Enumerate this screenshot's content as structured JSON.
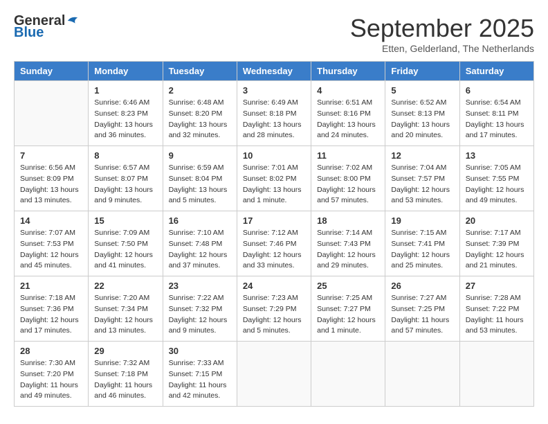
{
  "logo": {
    "general": "General",
    "blue": "Blue"
  },
  "header": {
    "month": "September 2025",
    "location": "Etten, Gelderland, The Netherlands"
  },
  "weekdays": [
    "Sunday",
    "Monday",
    "Tuesday",
    "Wednesday",
    "Thursday",
    "Friday",
    "Saturday"
  ],
  "weeks": [
    [
      {
        "day": "",
        "sunrise": "",
        "sunset": "",
        "daylight": ""
      },
      {
        "day": "1",
        "sunrise": "Sunrise: 6:46 AM",
        "sunset": "Sunset: 8:23 PM",
        "daylight": "Daylight: 13 hours and 36 minutes."
      },
      {
        "day": "2",
        "sunrise": "Sunrise: 6:48 AM",
        "sunset": "Sunset: 8:20 PM",
        "daylight": "Daylight: 13 hours and 32 minutes."
      },
      {
        "day": "3",
        "sunrise": "Sunrise: 6:49 AM",
        "sunset": "Sunset: 8:18 PM",
        "daylight": "Daylight: 13 hours and 28 minutes."
      },
      {
        "day": "4",
        "sunrise": "Sunrise: 6:51 AM",
        "sunset": "Sunset: 8:16 PM",
        "daylight": "Daylight: 13 hours and 24 minutes."
      },
      {
        "day": "5",
        "sunrise": "Sunrise: 6:52 AM",
        "sunset": "Sunset: 8:13 PM",
        "daylight": "Daylight: 13 hours and 20 minutes."
      },
      {
        "day": "6",
        "sunrise": "Sunrise: 6:54 AM",
        "sunset": "Sunset: 8:11 PM",
        "daylight": "Daylight: 13 hours and 17 minutes."
      }
    ],
    [
      {
        "day": "7",
        "sunrise": "Sunrise: 6:56 AM",
        "sunset": "Sunset: 8:09 PM",
        "daylight": "Daylight: 13 hours and 13 minutes."
      },
      {
        "day": "8",
        "sunrise": "Sunrise: 6:57 AM",
        "sunset": "Sunset: 8:07 PM",
        "daylight": "Daylight: 13 hours and 9 minutes."
      },
      {
        "day": "9",
        "sunrise": "Sunrise: 6:59 AM",
        "sunset": "Sunset: 8:04 PM",
        "daylight": "Daylight: 13 hours and 5 minutes."
      },
      {
        "day": "10",
        "sunrise": "Sunrise: 7:01 AM",
        "sunset": "Sunset: 8:02 PM",
        "daylight": "Daylight: 13 hours and 1 minute."
      },
      {
        "day": "11",
        "sunrise": "Sunrise: 7:02 AM",
        "sunset": "Sunset: 8:00 PM",
        "daylight": "Daylight: 12 hours and 57 minutes."
      },
      {
        "day": "12",
        "sunrise": "Sunrise: 7:04 AM",
        "sunset": "Sunset: 7:57 PM",
        "daylight": "Daylight: 12 hours and 53 minutes."
      },
      {
        "day": "13",
        "sunrise": "Sunrise: 7:05 AM",
        "sunset": "Sunset: 7:55 PM",
        "daylight": "Daylight: 12 hours and 49 minutes."
      }
    ],
    [
      {
        "day": "14",
        "sunrise": "Sunrise: 7:07 AM",
        "sunset": "Sunset: 7:53 PM",
        "daylight": "Daylight: 12 hours and 45 minutes."
      },
      {
        "day": "15",
        "sunrise": "Sunrise: 7:09 AM",
        "sunset": "Sunset: 7:50 PM",
        "daylight": "Daylight: 12 hours and 41 minutes."
      },
      {
        "day": "16",
        "sunrise": "Sunrise: 7:10 AM",
        "sunset": "Sunset: 7:48 PM",
        "daylight": "Daylight: 12 hours and 37 minutes."
      },
      {
        "day": "17",
        "sunrise": "Sunrise: 7:12 AM",
        "sunset": "Sunset: 7:46 PM",
        "daylight": "Daylight: 12 hours and 33 minutes."
      },
      {
        "day": "18",
        "sunrise": "Sunrise: 7:14 AM",
        "sunset": "Sunset: 7:43 PM",
        "daylight": "Daylight: 12 hours and 29 minutes."
      },
      {
        "day": "19",
        "sunrise": "Sunrise: 7:15 AM",
        "sunset": "Sunset: 7:41 PM",
        "daylight": "Daylight: 12 hours and 25 minutes."
      },
      {
        "day": "20",
        "sunrise": "Sunrise: 7:17 AM",
        "sunset": "Sunset: 7:39 PM",
        "daylight": "Daylight: 12 hours and 21 minutes."
      }
    ],
    [
      {
        "day": "21",
        "sunrise": "Sunrise: 7:18 AM",
        "sunset": "Sunset: 7:36 PM",
        "daylight": "Daylight: 12 hours and 17 minutes."
      },
      {
        "day": "22",
        "sunrise": "Sunrise: 7:20 AM",
        "sunset": "Sunset: 7:34 PM",
        "daylight": "Daylight: 12 hours and 13 minutes."
      },
      {
        "day": "23",
        "sunrise": "Sunrise: 7:22 AM",
        "sunset": "Sunset: 7:32 PM",
        "daylight": "Daylight: 12 hours and 9 minutes."
      },
      {
        "day": "24",
        "sunrise": "Sunrise: 7:23 AM",
        "sunset": "Sunset: 7:29 PM",
        "daylight": "Daylight: 12 hours and 5 minutes."
      },
      {
        "day": "25",
        "sunrise": "Sunrise: 7:25 AM",
        "sunset": "Sunset: 7:27 PM",
        "daylight": "Daylight: 12 hours and 1 minute."
      },
      {
        "day": "26",
        "sunrise": "Sunrise: 7:27 AM",
        "sunset": "Sunset: 7:25 PM",
        "daylight": "Daylight: 11 hours and 57 minutes."
      },
      {
        "day": "27",
        "sunrise": "Sunrise: 7:28 AM",
        "sunset": "Sunset: 7:22 PM",
        "daylight": "Daylight: 11 hours and 53 minutes."
      }
    ],
    [
      {
        "day": "28",
        "sunrise": "Sunrise: 7:30 AM",
        "sunset": "Sunset: 7:20 PM",
        "daylight": "Daylight: 11 hours and 49 minutes."
      },
      {
        "day": "29",
        "sunrise": "Sunrise: 7:32 AM",
        "sunset": "Sunset: 7:18 PM",
        "daylight": "Daylight: 11 hours and 46 minutes."
      },
      {
        "day": "30",
        "sunrise": "Sunrise: 7:33 AM",
        "sunset": "Sunset: 7:15 PM",
        "daylight": "Daylight: 11 hours and 42 minutes."
      },
      {
        "day": "",
        "sunrise": "",
        "sunset": "",
        "daylight": ""
      },
      {
        "day": "",
        "sunrise": "",
        "sunset": "",
        "daylight": ""
      },
      {
        "day": "",
        "sunrise": "",
        "sunset": "",
        "daylight": ""
      },
      {
        "day": "",
        "sunrise": "",
        "sunset": "",
        "daylight": ""
      }
    ]
  ]
}
